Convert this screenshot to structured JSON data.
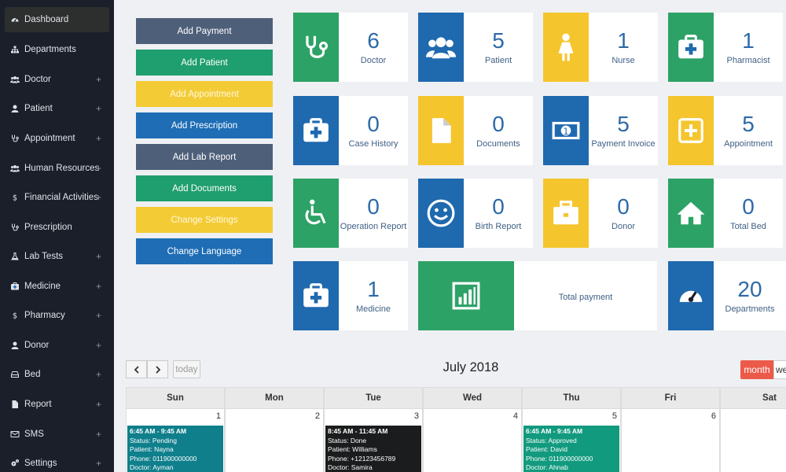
{
  "sidebar": {
    "items": [
      {
        "label": "Dashboard",
        "icon": "dashboard-icon",
        "plus": ""
      },
      {
        "label": "Departments",
        "icon": "sitemap-icon",
        "plus": ""
      },
      {
        "label": "Doctor",
        "icon": "users-icon",
        "plus": "+"
      },
      {
        "label": "Patient",
        "icon": "user-icon",
        "plus": "+"
      },
      {
        "label": "Appointment",
        "icon": "stethoscope-icon",
        "plus": "+"
      },
      {
        "label": "Human Resources",
        "icon": "users-icon",
        "plus": "+"
      },
      {
        "label": "Financial Activities",
        "icon": "dollar-icon",
        "plus": "+"
      },
      {
        "label": "Prescription",
        "icon": "stethoscope-icon",
        "plus": ""
      },
      {
        "label": "Lab Tests",
        "icon": "flask-icon",
        "plus": "+"
      },
      {
        "label": "Medicine",
        "icon": "medkit-icon",
        "plus": "+"
      },
      {
        "label": "Pharmacy",
        "icon": "dollar-icon",
        "plus": "+"
      },
      {
        "label": "Donor",
        "icon": "user-icon",
        "plus": "+"
      },
      {
        "label": "Bed",
        "icon": "hdd-icon",
        "plus": "+"
      },
      {
        "label": "Report",
        "icon": "file-icon",
        "plus": "+"
      },
      {
        "label": "SMS",
        "icon": "envelope-icon",
        "plus": "+"
      },
      {
        "label": "Settings",
        "icon": "gears-icon",
        "plus": "+"
      }
    ]
  },
  "quick_actions": [
    {
      "label": "Add Payment"
    },
    {
      "label": "Add Patient"
    },
    {
      "label": "Add Appointment"
    },
    {
      "label": "Add Prescription"
    },
    {
      "label": "Add Lab Report"
    },
    {
      "label": "Add Documents"
    },
    {
      "label": "Change Settings"
    },
    {
      "label": "Change Language"
    }
  ],
  "stats": [
    {
      "count": "6",
      "label": "Doctor",
      "icon": "stethoscope-icon",
      "color": "#2da266"
    },
    {
      "count": "5",
      "label": "Patient",
      "icon": "users-icon",
      "color": "#1f69af"
    },
    {
      "count": "1",
      "label": "Nurse",
      "icon": "female-icon",
      "color": "#f5c52e"
    },
    {
      "count": "1",
      "label": "Pharmacist",
      "icon": "medkit-icon",
      "color": "#2da266"
    },
    {
      "count": "0",
      "label": "Case History",
      "icon": "medkit-icon",
      "color": "#1f69af"
    },
    {
      "count": "0",
      "label": "Documents",
      "icon": "file-icon",
      "color": "#f5c52e"
    },
    {
      "count": "5",
      "label": "Payment Invoice",
      "icon": "money-icon",
      "color": "#1f69af"
    },
    {
      "count": "5",
      "label": "Appointment",
      "icon": "plus-square-icon",
      "color": "#f5c52e"
    },
    {
      "count": "0",
      "label": "Operation Report",
      "icon": "wheelchair-icon",
      "color": "#2da266"
    },
    {
      "count": "0",
      "label": "Birth Report",
      "icon": "smile-icon",
      "color": "#1f69af"
    },
    {
      "count": "0",
      "label": "Donor",
      "icon": "briefcase-icon",
      "color": "#f5c52e"
    },
    {
      "count": "0",
      "label": "Total Bed",
      "icon": "home-icon",
      "color": "#2da266"
    },
    {
      "count": "1",
      "label": "Medicine",
      "icon": "medkit-icon",
      "color": "#1f69af"
    },
    {
      "count": "",
      "label": "Total payment",
      "icon": "bar-chart-icon",
      "color": "#2da266"
    },
    {
      "count": "20",
      "label": "Departments",
      "icon": "dashboard-icon",
      "color": "#1f69af"
    }
  ],
  "calendar": {
    "title": "July 2018",
    "prev_icon": "chevron-left-icon",
    "next_icon": "chevron-right-icon",
    "today_label": "today",
    "views": [
      "month",
      "we"
    ],
    "days": [
      "Sun",
      "Mon",
      "Tue",
      "Wed",
      "Thu",
      "Fri",
      "Sat"
    ],
    "dates": [
      "1",
      "2",
      "3",
      "4",
      "5",
      "6",
      ""
    ],
    "events": [
      {
        "day_index": 0,
        "color": "#0f7f8c",
        "time": "6:45 AM - 9:45 AM",
        "status": "Status: Pending",
        "patient": "Patient: Nayna",
        "phone": "Phone: 011900000000",
        "doctor": "Doctor: Ayman"
      },
      {
        "day_index": 2,
        "color": "#1b1c1d",
        "time": "8:45 AM - 11:45 AM",
        "status": "Status: Done",
        "patient": "Patient: Williams",
        "phone": "Phone: +12123456789",
        "doctor": "Doctor: Samira"
      },
      {
        "day_index": 4,
        "color": "#129a7e",
        "time": "6:45 AM - 9:45 AM",
        "status": "Status: Approved",
        "patient": "Patient: David",
        "phone": "Phone: 011900000000",
        "doctor": "Doctor: Ahnab"
      }
    ]
  }
}
